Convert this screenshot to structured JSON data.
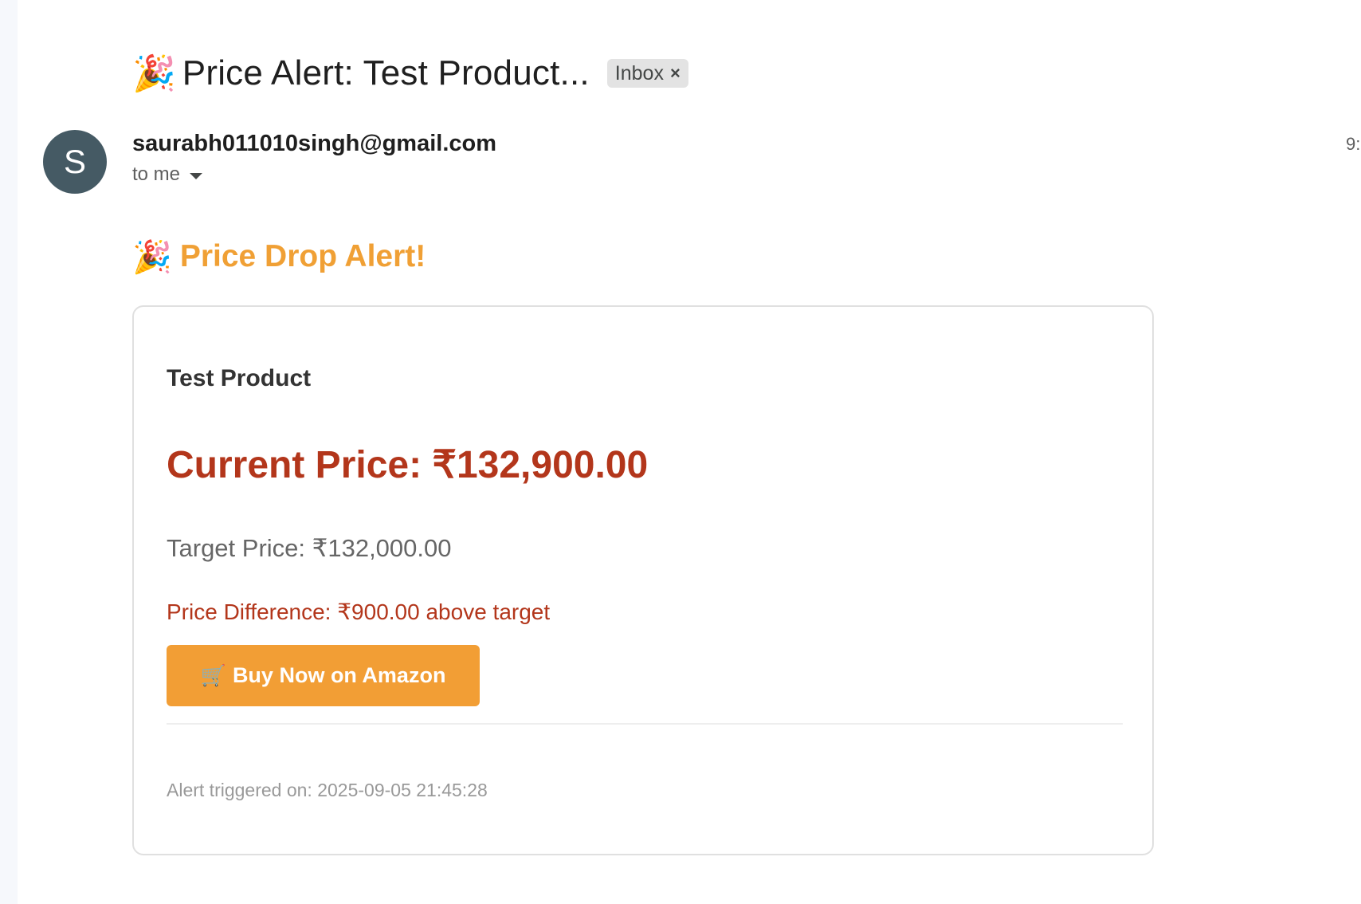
{
  "email": {
    "subject_emoji": "🎉",
    "subject": "Price Alert: Test Product...",
    "label_chip": "Inbox",
    "label_chip_close": "×",
    "avatar_letter": "S",
    "sender": "saurabh011010singh@gmail.com",
    "recipient": "to me",
    "time_partial": "9:",
    "colors": {
      "avatar_bg": "#455a64",
      "accent_orange": "#f0a035",
      "price_red": "#b3361b"
    }
  },
  "body": {
    "alert_emoji": "🎉",
    "alert_title": "Price Drop Alert!",
    "product_name": "Test Product",
    "current_price": "Current Price: ₹132,900.00",
    "target_price": "Target Price: ₹132,000.00",
    "price_difference": "Price Difference: ₹900.00 above target",
    "buy_button_icon": "🛒",
    "buy_button_label": "Buy Now on Amazon",
    "alert_triggered": "Alert triggered on: 2025-09-05 21:45:28"
  }
}
